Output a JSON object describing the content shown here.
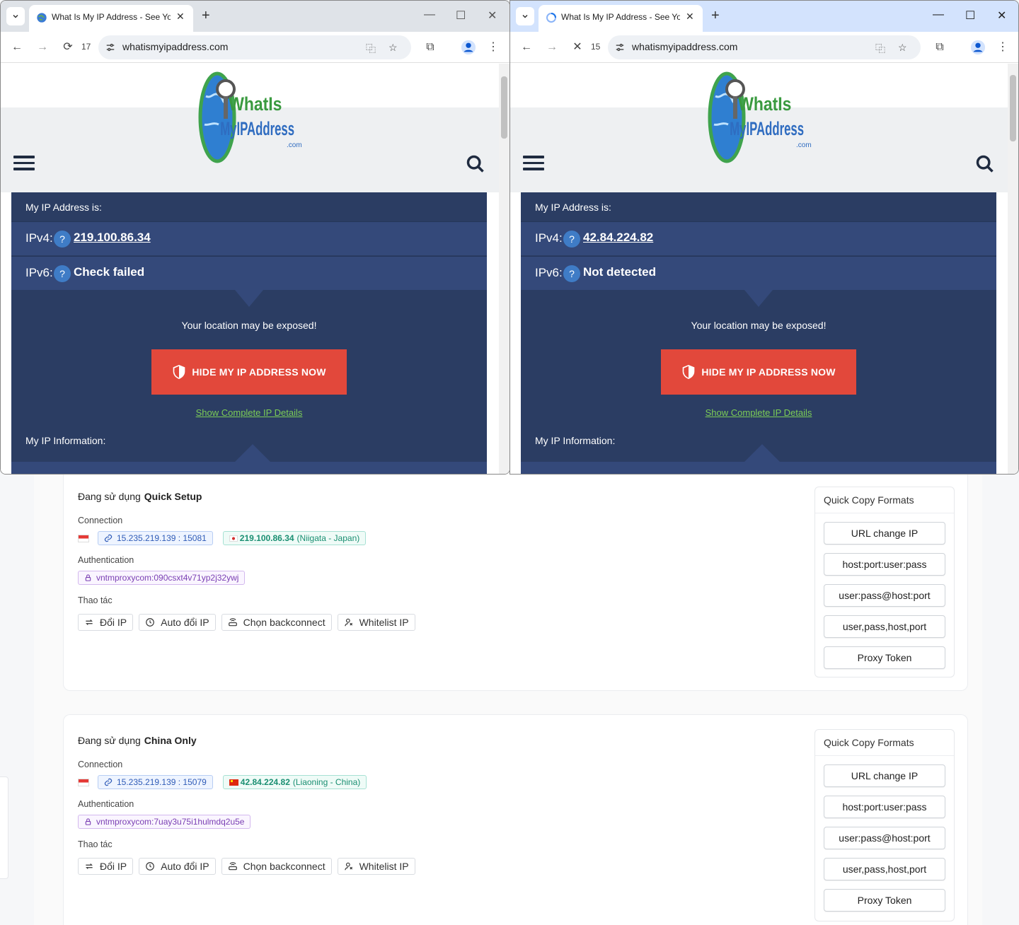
{
  "left_window": {
    "tab_title": "What Is My IP Address - See Yo",
    "counter": "17",
    "url": "whatismyipaddress.com",
    "panel": {
      "title": "My IP Address is:",
      "ipv4_label": "IPv4:",
      "ipv4_value": "219.100.86.34",
      "ipv6_label": "IPv6:",
      "ipv6_value": "Check failed",
      "exposed_text": "Your location may be exposed!",
      "hide_button": "HIDE MY IP ADDRESS NOW",
      "details_link": "Show Complete IP Details",
      "info_label": "My IP Information:"
    }
  },
  "right_window": {
    "tab_title": "What Is My IP Address - See Yo",
    "counter": "15",
    "url": "whatismyipaddress.com",
    "panel": {
      "title": "My IP Address is:",
      "ipv4_label": "IPv4:",
      "ipv4_value": "42.84.224.82",
      "ipv6_label": "IPv6:",
      "ipv6_value": "Not detected",
      "exposed_text": "Your location may be exposed!",
      "hide_button": "HIDE MY IP ADDRESS NOW",
      "details_link": "Show Complete IP Details",
      "info_label": "My IP Information:"
    }
  },
  "logo": {
    "line1": "WhatIs",
    "line2": "MyIPAddress",
    "line3": ".com"
  },
  "cards": [
    {
      "using_prefix": "Đang sử dụng",
      "plan": "Quick Setup",
      "connection_label": "Connection",
      "endpoint": "15.235.219.139 : 15081",
      "exit_ip": "219.100.86.34",
      "exit_location": "(Niigata - Japan)",
      "auth_label": "Authentication",
      "auth": "vntmproxycom:090csxt4v71yp2j32ywj",
      "actions_label": "Thao tác",
      "actions": [
        "Đổi IP",
        "Auto đổi IP",
        "Chọn backconnect",
        "Whitelist IP"
      ]
    },
    {
      "using_prefix": "Đang sử dụng",
      "plan": "China Only",
      "connection_label": "Connection",
      "endpoint": "15.235.219.139 : 15079",
      "exit_ip": "42.84.224.82",
      "exit_location": "(Liaoning - China)",
      "auth_label": "Authentication",
      "auth": "vntmproxycom:7uay3u75i1hulmdq2u5e",
      "actions_label": "Thao tác",
      "actions": [
        "Đổi IP",
        "Auto đổi IP",
        "Chọn backconnect",
        "Whitelist IP"
      ]
    }
  ],
  "quick_copy": {
    "title": "Quick Copy Formats",
    "buttons": [
      "URL change IP",
      "host:port:user:pass",
      "user:pass@host:port",
      "user,pass,host,port",
      "Proxy Token"
    ]
  },
  "colors": {
    "panel_bg": "#2b3d63",
    "panel_row": "#34497a",
    "hide_button": "#e2483b",
    "details_link": "#7ccd56",
    "chip_blue": "#2f5bb7",
    "chip_green": "#1a8f72",
    "chip_purple": "#7a3fb3"
  }
}
